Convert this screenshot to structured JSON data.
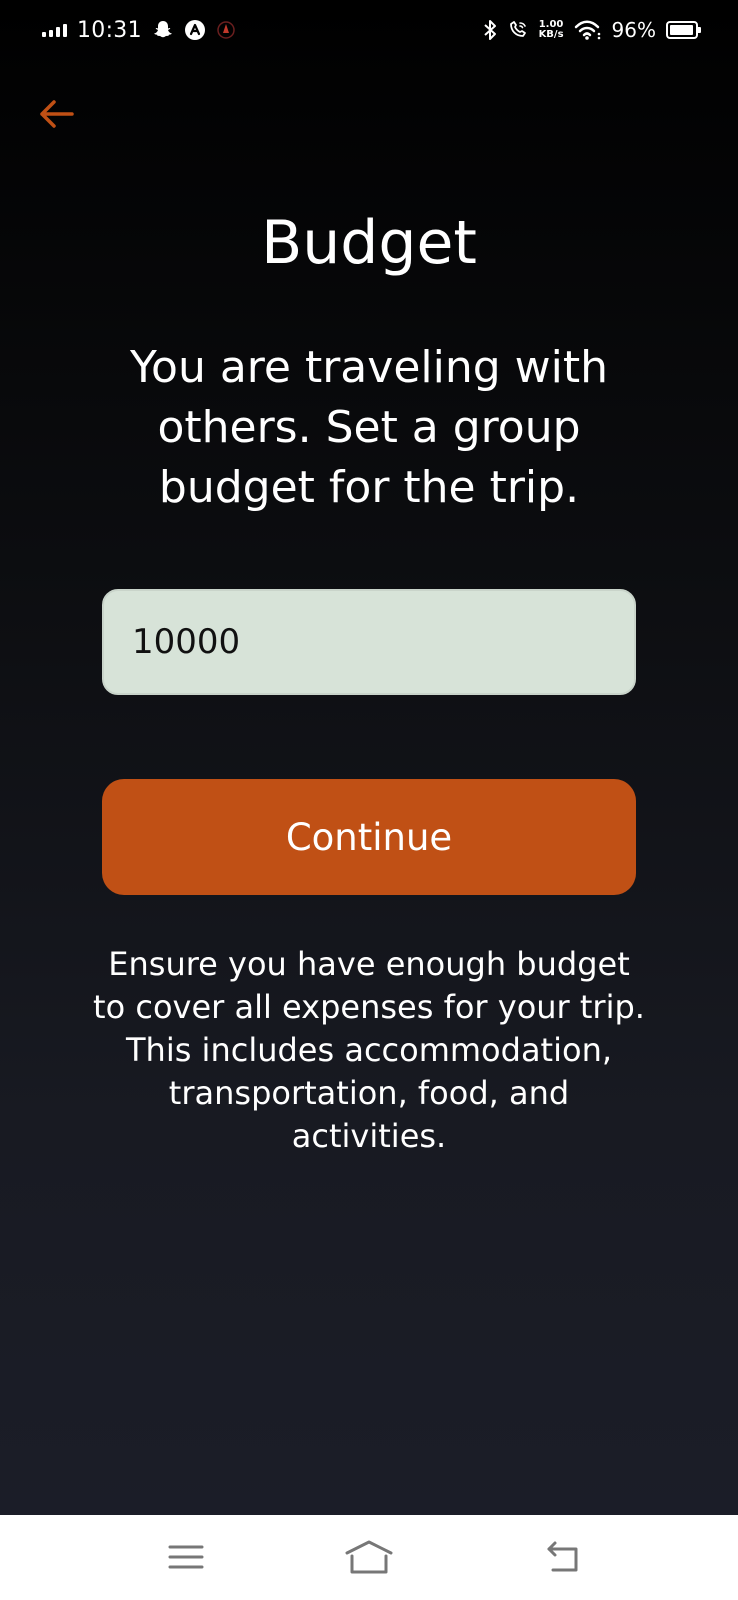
{
  "status_bar": {
    "time": "10:31",
    "net_speed_value": "1.00",
    "net_speed_unit": "KB/s",
    "battery_percent": "96%",
    "battery_level": 0.96
  },
  "header": {
    "back_icon": "arrow-left-icon",
    "title": "Budget"
  },
  "main": {
    "subtitle": "You are traveling with others. Set a group budget for the trip.",
    "budget_value": "10000",
    "continue_label": "Continue",
    "info_text": "Ensure you have enough budget to cover all expenses for your trip. This includes accommodation, transportation, food, and activities."
  },
  "nav_bar": {
    "icons": [
      "menu-icon",
      "home-icon",
      "back-icon"
    ]
  },
  "colors": {
    "accent": "#c05015",
    "input_bg": "#d7e3d8",
    "background": "#0c0d10"
  }
}
